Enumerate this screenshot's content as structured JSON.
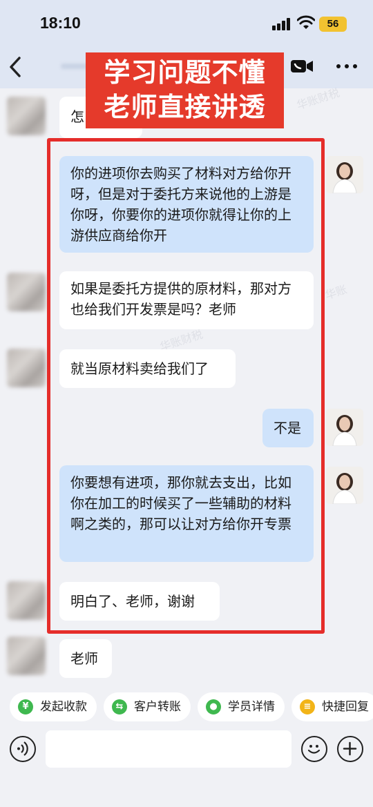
{
  "status_bar": {
    "time": "18:10",
    "battery": "56"
  },
  "overlay": {
    "line1": "学习问题不懂",
    "line2": "老师直接讲透"
  },
  "messages": [
    {
      "side": "in",
      "text": "怎"
    },
    {
      "side": "out",
      "text": "你的进项你去购买了材料对方给你开呀，但是对于委托方来说他的上游是你呀，你要你的进项你就得让你的上游供应商给你开"
    },
    {
      "side": "in",
      "text": "如果是委托方提供的原材料，那对方也给我们开发票是吗？老师"
    },
    {
      "side": "in",
      "text": "就当原材料卖给我们了"
    },
    {
      "side": "out",
      "text": "不是"
    },
    {
      "side": "out",
      "text": "你要想有进项，那你就去支出，比如你在加工的时候买了一些辅助的材料啊之类的，那可以让对方给你开专票"
    },
    {
      "side": "in",
      "text": "明白了、老师，谢谢"
    },
    {
      "side": "in",
      "text": "老师"
    }
  ],
  "quick_actions": [
    {
      "label": "发起收款",
      "icon": "yuan-icon",
      "color": "#3fb84f",
      "glyph": "¥"
    },
    {
      "label": "客户转账",
      "icon": "transfer-icon",
      "color": "#3fb84f",
      "glyph": "⇆"
    },
    {
      "label": "学员详情",
      "icon": "student-icon",
      "color": "#3fb84f",
      "glyph": "●"
    },
    {
      "label": "快捷回复",
      "icon": "quick-reply-icon",
      "color": "#f2b418",
      "glyph": "≡"
    }
  ],
  "colors": {
    "header_bg": "#dfe6f3",
    "outgoing_bubble": "#cfe3fb",
    "incoming_bubble": "#ffffff",
    "highlight_frame": "#e52d2a",
    "banner_bg": "#e53a2b"
  }
}
